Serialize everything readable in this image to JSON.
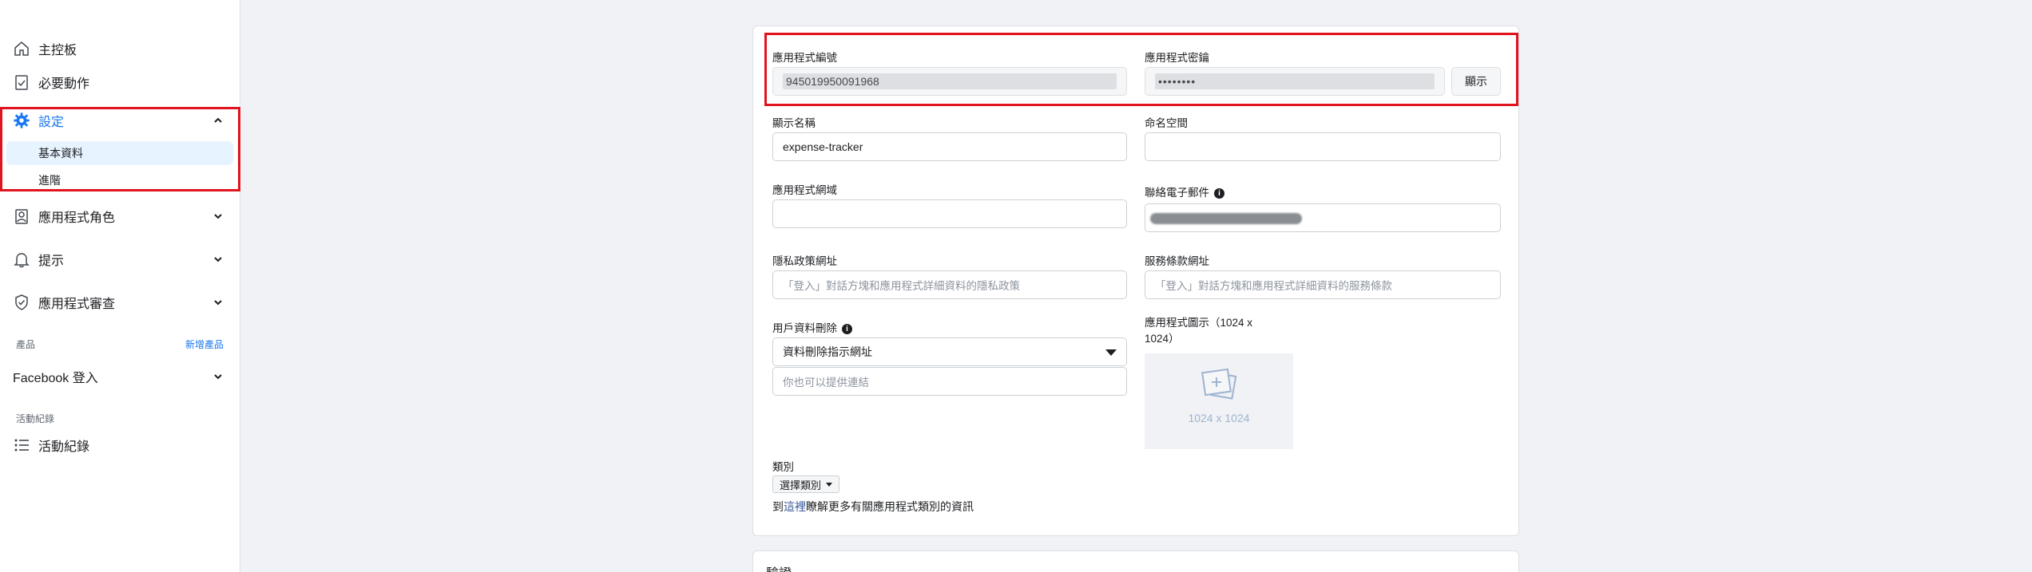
{
  "sidebar": {
    "items": [
      {
        "label": "主控板",
        "icon": "home-icon"
      },
      {
        "label": "必要動作",
        "icon": "checklist-icon"
      },
      {
        "label": "設定",
        "icon": "gear-icon"
      },
      {
        "label": "應用程式角色",
        "icon": "roles-icon"
      },
      {
        "label": "提示",
        "icon": "bell-icon"
      },
      {
        "label": "應用程式審查",
        "icon": "shield-check-icon"
      },
      {
        "label": "Facebook 登入"
      },
      {
        "label": "活動紀錄",
        "icon": "list-icon"
      }
    ],
    "settings_sub": [
      {
        "label": "基本資料"
      },
      {
        "label": "進階"
      }
    ],
    "products_label": "產品",
    "add_product": "新增產品",
    "activity_section_label": "活動紀錄"
  },
  "form": {
    "app_id_label": "應用程式編號",
    "app_id_value": "945019950091968",
    "app_secret_label": "應用程式密鑰",
    "app_secret_value": "••••••••",
    "show_button": "顯示",
    "display_name_label": "顯示名稱",
    "display_name_value": "expense-tracker",
    "namespace_label": "命名空間",
    "app_domain_label": "應用程式網域",
    "contact_email_label": "聯絡電子郵件",
    "privacy_url_label": "隱私政策網址",
    "privacy_url_placeholder": "「登入」對話方塊和應用程式詳細資料的隱私政策",
    "terms_url_label": "服務條款網址",
    "terms_url_placeholder": "「登入」對話方塊和應用程式詳細資料的服務條款",
    "data_deletion_label": "用戶資料刪除",
    "data_deletion_select": "資料刪除指示網址",
    "data_deletion_placeholder": "你也可以提供連結",
    "app_icon_label": "應用程式圖示（1024 x 1024）",
    "app_icon_size": "1024 x 1024",
    "category_label": "類別",
    "category_select": "選擇類別",
    "category_help_prefix": "到",
    "category_help_link": "這裡",
    "category_help_suffix": "瞭解更多有關應用程式類別的資訊"
  },
  "next_card_title": "驗證",
  "colors": {
    "accent": "#1877f2",
    "highlight": "#e0141e"
  }
}
